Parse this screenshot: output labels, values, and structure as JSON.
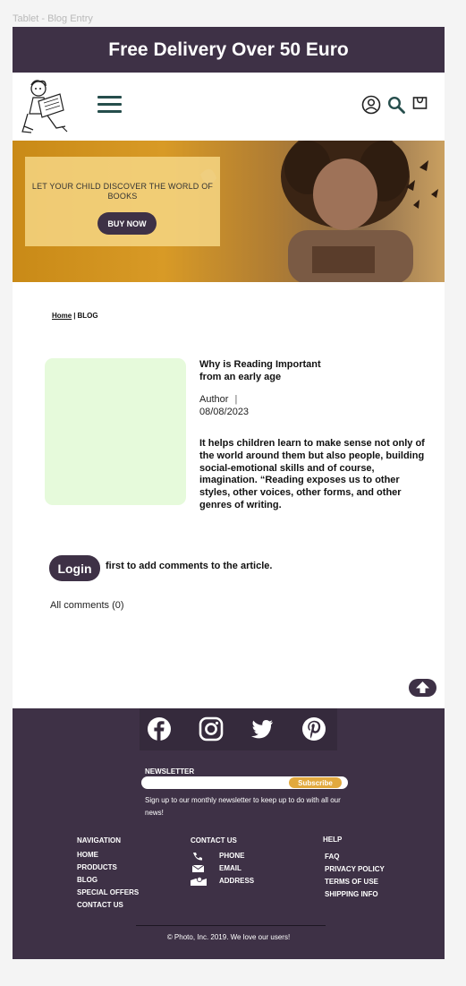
{
  "frame_label": "Tablet - Blog Entry",
  "promo": {
    "text": "Free Delivery Over 50 Euro"
  },
  "header": {
    "icons": [
      "logo-illustration",
      "hamburger-menu-icon",
      "user-icon",
      "search-icon",
      "shopping-bag-icon"
    ]
  },
  "hero": {
    "headline": "LET YOUR CHILD DISCOVER THE WORLD OF BOOKS",
    "cta": "BUY NOW"
  },
  "breadcrumb": {
    "home": "Home",
    "separator": "|",
    "current": "BLOG"
  },
  "article": {
    "title": "Why is Reading Important from an early age",
    "author": "Author",
    "author_separator": "|",
    "date": "08/08/2023",
    "body": "It helps children learn to make sense not only of the world around them but also people, building social-emotional skills and of course, imagination. “Reading exposes us to other styles, other voices, other forms, and other genres of writing."
  },
  "comments": {
    "login_button": "Login",
    "login_note": "first to add comments to the article.",
    "count_label": "All comments (0)"
  },
  "footer": {
    "social_icons": [
      "facebook-icon",
      "instagram-icon",
      "twitter-icon",
      "pinterest-icon"
    ],
    "newsletter": {
      "title": "NEWSLETTER",
      "input_value": "",
      "subscribe": "Subscribe",
      "description": "Sign up to our monthly newsletter to keep up to do with all our news!"
    },
    "navigation": {
      "title": "NAVIGATION",
      "items": [
        "HOME",
        "PRODUCTS",
        "BLOG",
        "SPECIAL OFFERS",
        "CONTACT US"
      ]
    },
    "contact": {
      "title": "CONTACT US",
      "items": [
        "PHONE",
        "EMAIL",
        "ADDRESS"
      ]
    },
    "help": {
      "title": "HELP",
      "items": [
        "FAQ",
        "PRIVACY POLICY",
        "TERMS OF USE",
        "SHIPPING INFO"
      ]
    },
    "copyright": "© Photo, Inc. 2019. We love our users!"
  },
  "colors": {
    "brand_dark": "#3e3146",
    "accent_teal": "#264e4c",
    "accent_gold": "#e2a93e",
    "article_image_bg": "#e6fadb"
  }
}
